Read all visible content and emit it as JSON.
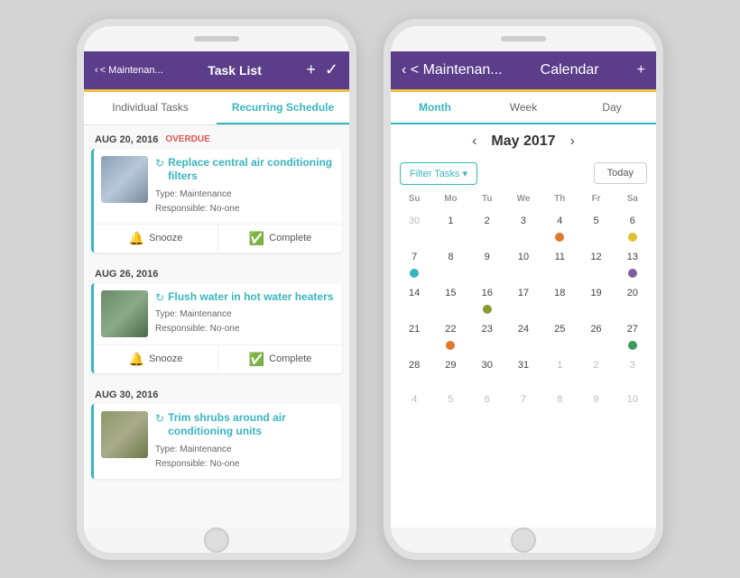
{
  "phone1": {
    "header": {
      "back_label": "< Maintenan...",
      "title": "Task List",
      "add_icon": "+",
      "check_icon": "✓"
    },
    "tabs": [
      {
        "label": "Individual Tasks",
        "active": false
      },
      {
        "label": "Recurring Schedule",
        "active": true
      }
    ],
    "tasks": [
      {
        "date": "AUG 20, 2016",
        "overdue": "OVERDUE",
        "title": "Replace central air conditioning filters",
        "type": "Maintenance",
        "responsible": "No-one",
        "snooze_label": "Snooze",
        "complete_label": "Complete",
        "thumb_class": "thumb-ac"
      },
      {
        "date": "AUG 26, 2016",
        "overdue": "",
        "title": "Flush water in hot water heaters",
        "type": "Maintenance",
        "responsible": "No-one",
        "snooze_label": "Snooze",
        "complete_label": "Complete",
        "thumb_class": "thumb-water"
      },
      {
        "date": "AUG 30, 2016",
        "overdue": "",
        "title": "Trim shrubs around air conditioning units",
        "type": "Maintenance",
        "responsible": "No-one",
        "snooze_label": "Snooze",
        "complete_label": "Complete",
        "thumb_class": "thumb-trim"
      }
    ]
  },
  "phone2": {
    "header": {
      "back_label": "< Maintenan...",
      "title": "Calendar",
      "add_icon": "+"
    },
    "tabs": [
      {
        "label": "Month",
        "active": true
      },
      {
        "label": "Week",
        "active": false
      },
      {
        "label": "Day",
        "active": false
      }
    ],
    "month_nav": {
      "prev": "‹",
      "next": "›",
      "title": "May 2017"
    },
    "filter_btn": "Filter Tasks ▾",
    "today_btn": "Today",
    "dow": [
      "Su",
      "Mo",
      "Tu",
      "We",
      "Th",
      "Fr",
      "Sa"
    ],
    "weeks": [
      [
        {
          "num": "30",
          "other": true,
          "dot": null
        },
        {
          "num": "1",
          "other": false,
          "dot": null
        },
        {
          "num": "2",
          "other": false,
          "dot": null
        },
        {
          "num": "3",
          "other": false,
          "dot": null
        },
        {
          "num": "4",
          "other": false,
          "dot": "dot-orange"
        },
        {
          "num": "5",
          "other": false,
          "dot": null
        },
        {
          "num": "6",
          "other": false,
          "dot": "dot-yellow"
        }
      ],
      [
        {
          "num": "7",
          "other": false,
          "dot": "dot-blue"
        },
        {
          "num": "8",
          "other": false,
          "dot": null
        },
        {
          "num": "9",
          "other": false,
          "dot": null
        },
        {
          "num": "10",
          "other": false,
          "dot": null
        },
        {
          "num": "11",
          "other": false,
          "dot": null
        },
        {
          "num": "12",
          "other": false,
          "dot": null
        },
        {
          "num": "13",
          "other": false,
          "dot": "dot-purple"
        }
      ],
      [
        {
          "num": "14",
          "other": false,
          "dot": null
        },
        {
          "num": "15",
          "other": false,
          "dot": null
        },
        {
          "num": "16",
          "other": false,
          "dot": "dot-olive"
        },
        {
          "num": "17",
          "other": false,
          "dot": null
        },
        {
          "num": "18",
          "other": false,
          "dot": null
        },
        {
          "num": "19",
          "other": false,
          "dot": null
        },
        {
          "num": "20",
          "other": false,
          "dot": null
        }
      ],
      [
        {
          "num": "21",
          "other": false,
          "dot": null
        },
        {
          "num": "22",
          "other": false,
          "dot": "dot-orange"
        },
        {
          "num": "23",
          "other": false,
          "dot": null
        },
        {
          "num": "24",
          "other": false,
          "dot": null
        },
        {
          "num": "25",
          "other": false,
          "dot": null
        },
        {
          "num": "26",
          "other": false,
          "dot": null
        },
        {
          "num": "27",
          "other": false,
          "dot": "dot-green"
        }
      ],
      [
        {
          "num": "28",
          "other": false,
          "dot": null
        },
        {
          "num": "29",
          "other": false,
          "dot": null
        },
        {
          "num": "30",
          "other": false,
          "dot": null
        },
        {
          "num": "31",
          "other": false,
          "dot": null
        },
        {
          "num": "1",
          "other": true,
          "dot": null
        },
        {
          "num": "2",
          "other": true,
          "dot": null
        },
        {
          "num": "3",
          "other": true,
          "dot": null
        }
      ],
      [
        {
          "num": "4",
          "other": true,
          "dot": null
        },
        {
          "num": "5",
          "other": true,
          "dot": null
        },
        {
          "num": "6",
          "other": true,
          "dot": null
        },
        {
          "num": "7",
          "other": true,
          "dot": null
        },
        {
          "num": "8",
          "other": true,
          "dot": null
        },
        {
          "num": "9",
          "other": true,
          "dot": null
        },
        {
          "num": "10",
          "other": true,
          "dot": null
        }
      ]
    ]
  }
}
